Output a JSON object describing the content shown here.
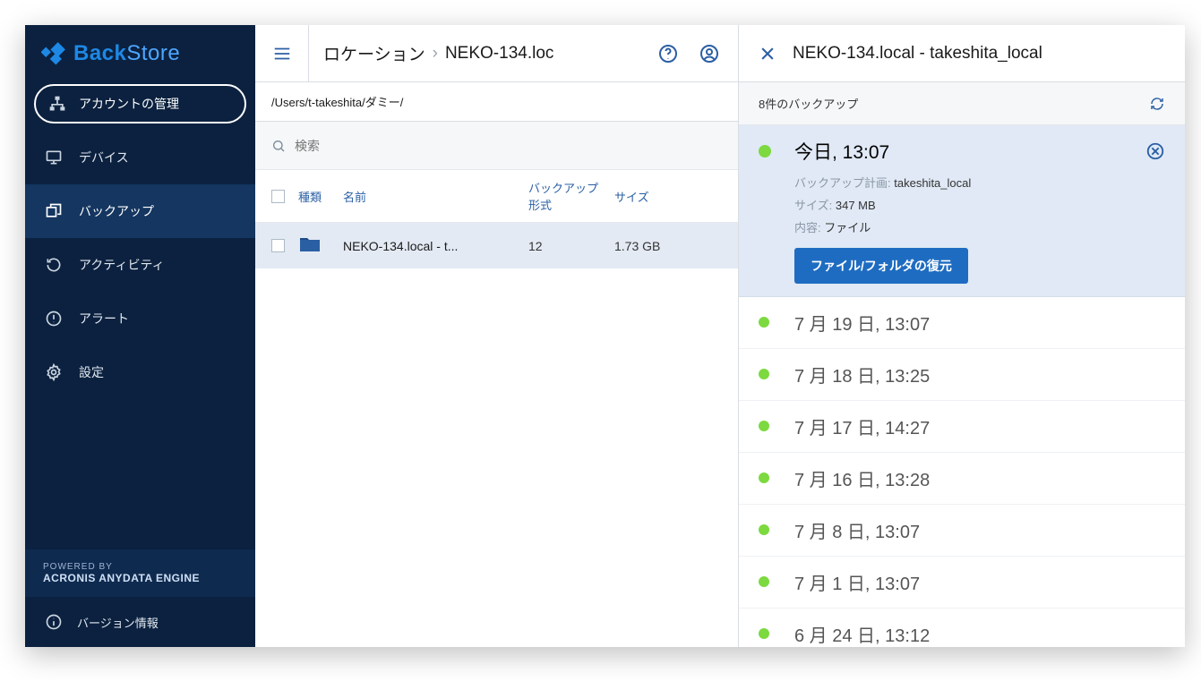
{
  "app": {
    "brand_a": "Back",
    "brand_b": "Store"
  },
  "sidebar": {
    "accountBtn": "アカウントの管理",
    "nav": [
      {
        "label": "デバイス"
      },
      {
        "label": "バックアップ"
      },
      {
        "label": "アクティビティ"
      },
      {
        "label": "アラート"
      },
      {
        "label": "設定"
      }
    ],
    "powered_pre": "POWERED BY",
    "powered_main": "ACRONIS ANYDATA ENGINE",
    "version_label": "バージョン情報"
  },
  "breadcrumb": {
    "root": "ロケーション",
    "current": "NEKO-134.loc"
  },
  "path": "/Users/t-takeshita/ダミー/",
  "search": {
    "placeholder": "検索"
  },
  "table": {
    "headers": {
      "type": "種類",
      "name": "名前",
      "backup_format": "バックアップ形式",
      "size": "サイズ"
    },
    "rows": [
      {
        "name": "NEKO-134.local - t...",
        "backups": "12",
        "size": "1.73 GB"
      }
    ]
  },
  "rightPane": {
    "title": "NEKO-134.local - takeshita_local",
    "count_label": "8件のバックアップ",
    "expanded": {
      "date": "今日, 13:07",
      "plan_label": "バックアップ計画:",
      "plan_value": "takeshita_local",
      "size_label": "サイズ:",
      "size_value": "347 MB",
      "content_label": "内容:",
      "content_value": "ファイル",
      "restore_button": "ファイル/フォルダの復元"
    },
    "history": [
      "7 月 19 日, 13:07",
      "7 月 18 日, 13:25",
      "7 月 17 日, 14:27",
      "7 月 16 日, 13:28",
      "7 月 8 日, 13:07",
      "7 月 1 日, 13:07",
      "6 月 24 日, 13:12"
    ]
  }
}
